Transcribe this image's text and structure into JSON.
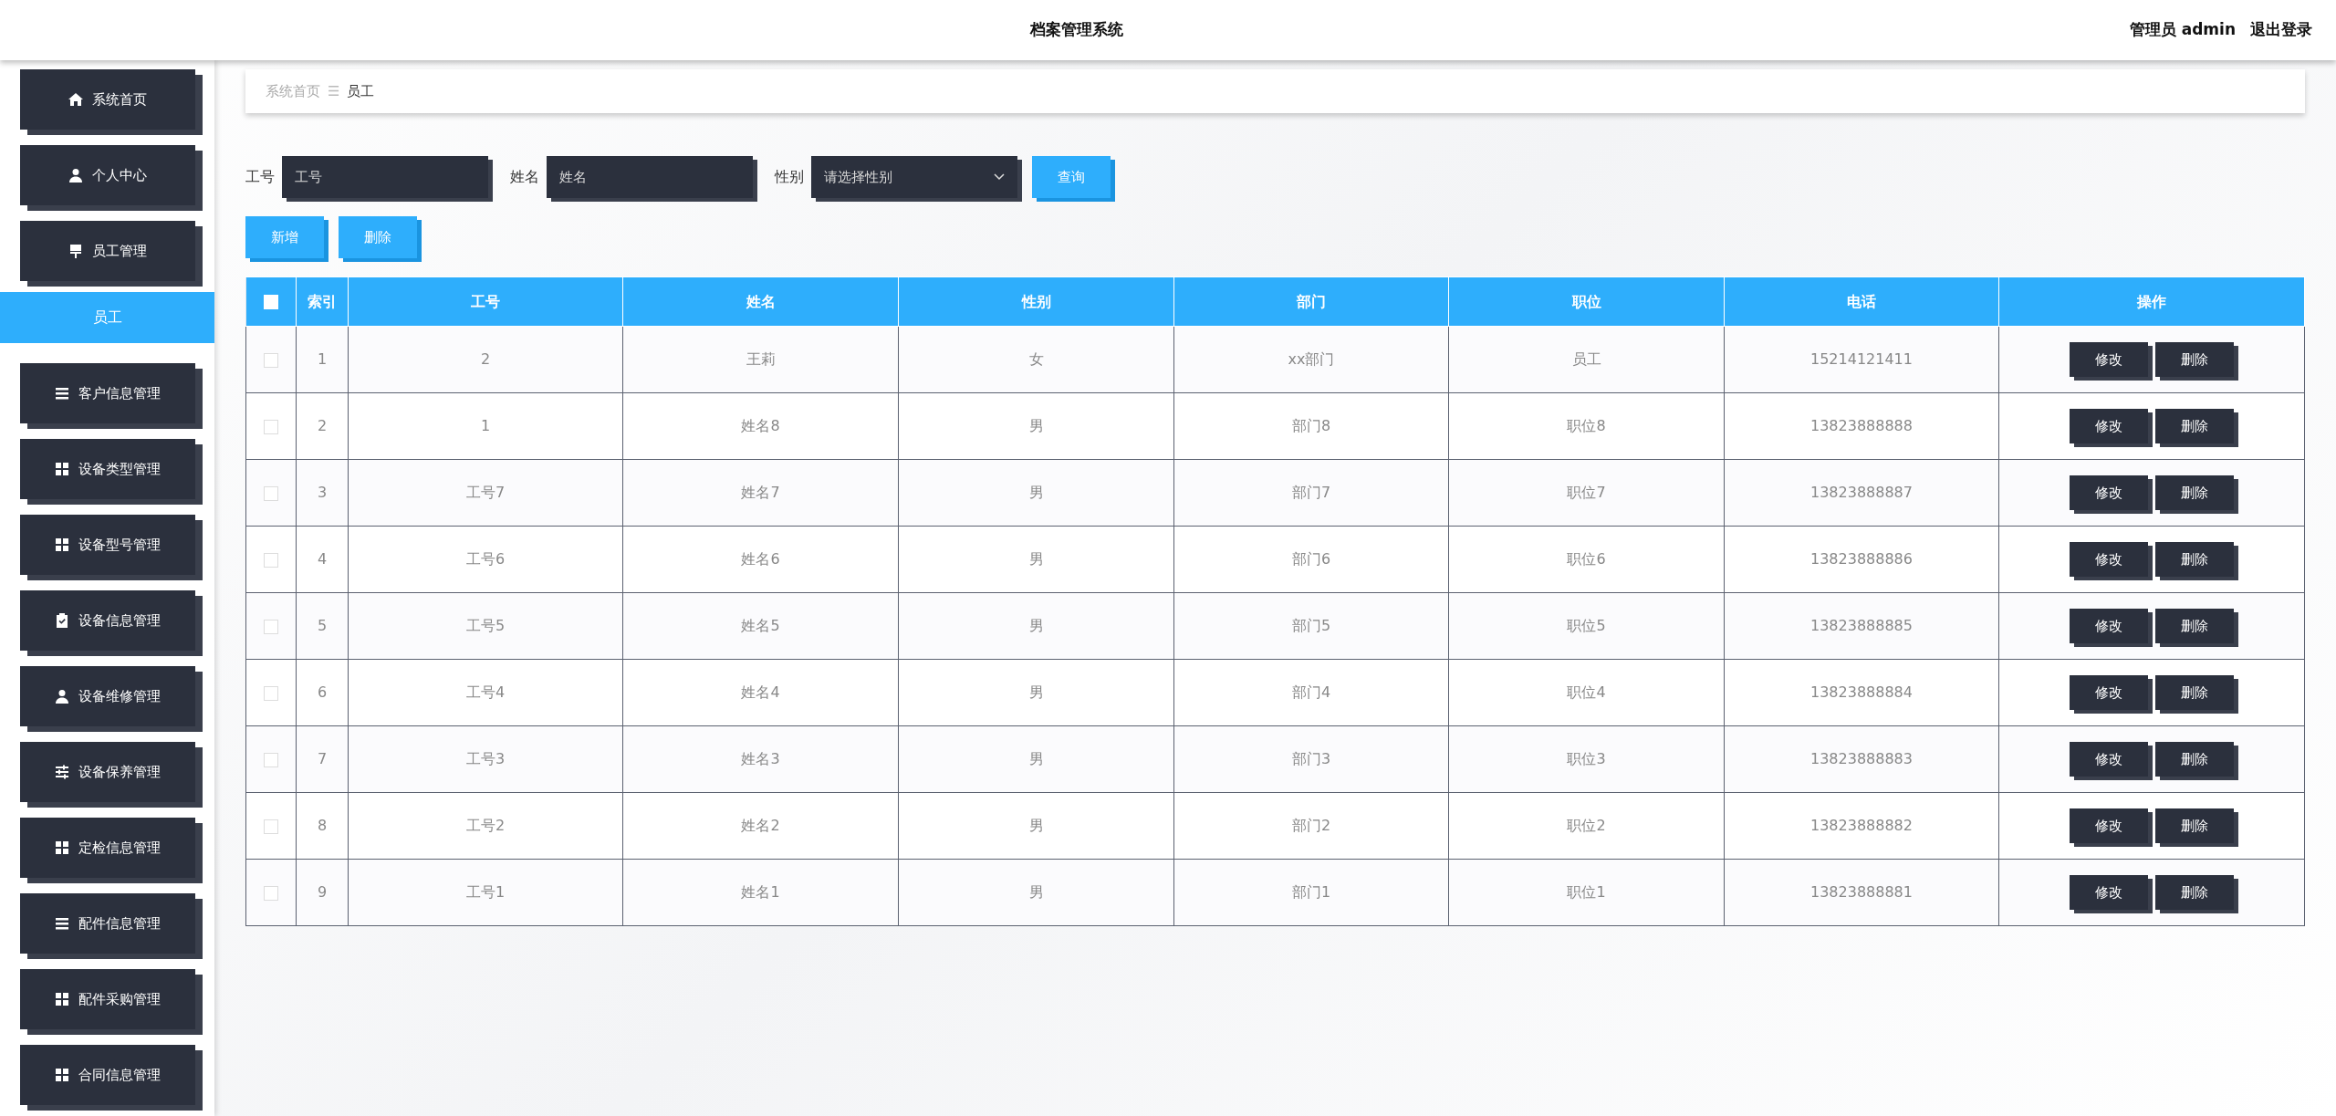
{
  "header": {
    "title": "档案管理系统",
    "user": "管理员 admin",
    "logout": "退出登录"
  },
  "sidebar": {
    "items": [
      {
        "label": "系统首页",
        "kind": "main",
        "selected": false
      },
      {
        "label": "个人中心",
        "kind": "main",
        "selected": false
      },
      {
        "label": "员工管理",
        "kind": "main",
        "selected": false
      },
      {
        "label": "员工",
        "kind": "sub",
        "selected": true
      },
      {
        "label": "客户信息管理",
        "kind": "main",
        "selected": false
      },
      {
        "label": "设备类型管理",
        "kind": "main",
        "selected": false
      },
      {
        "label": "设备型号管理",
        "kind": "main",
        "selected": false
      },
      {
        "label": "设备信息管理",
        "kind": "main",
        "selected": false
      },
      {
        "label": "设备维修管理",
        "kind": "main",
        "selected": false
      },
      {
        "label": "设备保养管理",
        "kind": "main",
        "selected": false
      },
      {
        "label": "定检信息管理",
        "kind": "main",
        "selected": false
      },
      {
        "label": "配件信息管理",
        "kind": "main",
        "selected": false
      },
      {
        "label": "配件采购管理",
        "kind": "main",
        "selected": false
      },
      {
        "label": "合同信息管理",
        "kind": "main",
        "selected": false
      }
    ]
  },
  "breadcrumb": {
    "items": [
      "系统首页",
      "员工"
    ],
    "separator": "☰"
  },
  "search": {
    "fields": [
      {
        "label": "工号",
        "placeholder": "工号",
        "kind": "text"
      },
      {
        "label": "姓名",
        "placeholder": "姓名",
        "kind": "text"
      },
      {
        "label": "性别",
        "placeholder": "请选择性别",
        "kind": "select"
      }
    ],
    "button": "查询"
  },
  "actions": [
    "新增",
    "删除"
  ],
  "table": {
    "select_all_checked": false,
    "columns": [
      "索引",
      "工号",
      "姓名",
      "性别",
      "部门",
      "职位",
      "电话",
      "操作"
    ],
    "rows": [
      {
        "checked": false,
        "cells": [
          "1",
          "2",
          "王莉",
          "女",
          "xx部门",
          "员工",
          "15214121411"
        ],
        "actions": [
          "修改",
          "删除"
        ]
      },
      {
        "checked": false,
        "cells": [
          "2",
          "1",
          "姓名8",
          "男",
          "部门8",
          "职位8",
          "13823888888"
        ],
        "actions": [
          "修改",
          "删除"
        ]
      },
      {
        "checked": false,
        "cells": [
          "3",
          "工号7",
          "姓名7",
          "男",
          "部门7",
          "职位7",
          "13823888887"
        ],
        "actions": [
          "修改",
          "删除"
        ]
      },
      {
        "checked": false,
        "cells": [
          "4",
          "工号6",
          "姓名6",
          "男",
          "部门6",
          "职位6",
          "13823888886"
        ],
        "actions": [
          "修改",
          "删除"
        ]
      },
      {
        "checked": false,
        "cells": [
          "5",
          "工号5",
          "姓名5",
          "男",
          "部门5",
          "职位5",
          "13823888885"
        ],
        "actions": [
          "修改",
          "删除"
        ]
      },
      {
        "checked": false,
        "cells": [
          "6",
          "工号4",
          "姓名4",
          "男",
          "部门4",
          "职位4",
          "13823888884"
        ],
        "actions": [
          "修改",
          "删除"
        ]
      },
      {
        "checked": false,
        "cells": [
          "7",
          "工号3",
          "姓名3",
          "男",
          "部门3",
          "职位3",
          "13823888883"
        ],
        "actions": [
          "修改",
          "删除"
        ]
      },
      {
        "checked": false,
        "cells": [
          "8",
          "工号2",
          "姓名2",
          "男",
          "部门2",
          "职位2",
          "13823888882"
        ],
        "actions": [
          "修改",
          "删除"
        ]
      },
      {
        "checked": false,
        "cells": [
          "9",
          "工号1",
          "姓名1",
          "男",
          "部门1",
          "职位1",
          "13823888881"
        ],
        "actions": [
          "修改",
          "删除"
        ]
      }
    ]
  }
}
